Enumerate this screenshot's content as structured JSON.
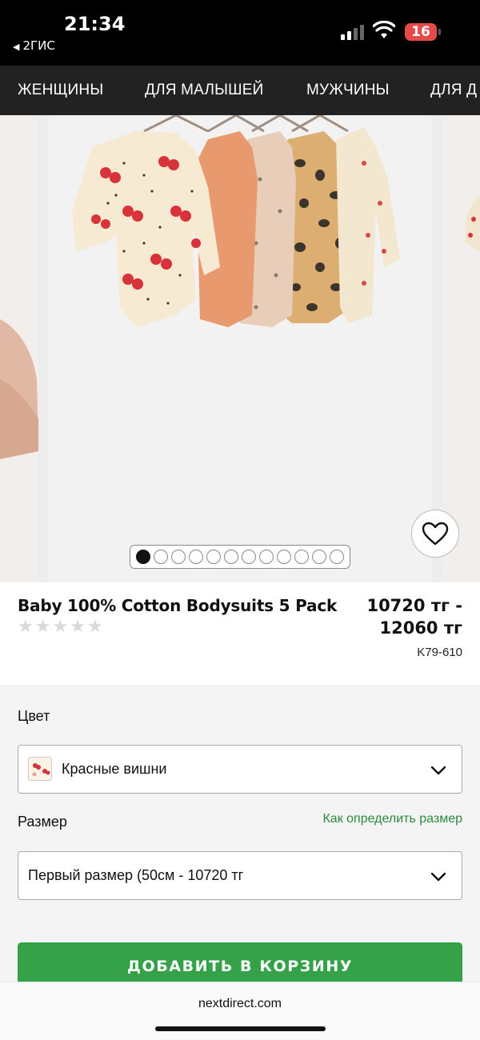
{
  "status_bar": {
    "time": "21:34",
    "back_app": "2ГИС",
    "battery": "16"
  },
  "nav": {
    "items": [
      "ЖЕНЩИНЫ",
      "ДЛЯ МАЛЫШЕЙ",
      "МУЖЧИНЫ",
      "ДЛЯ Д"
    ]
  },
  "gallery": {
    "image_count": 12,
    "active_index": 0
  },
  "product": {
    "title": "Baby 100% Cotton Bodysuits 5 Pack",
    "rating": 0,
    "price_line1": "10720 тг -",
    "price_line2": "12060 тг",
    "sku": "K79-610"
  },
  "options": {
    "color_label": "Цвет",
    "color_value": "Красные вишни",
    "size_label": "Размер",
    "size_guide_link": "Как определить размер",
    "size_value": "Первый размер (50см - 10720 тг"
  },
  "cta": {
    "label": "ДОБАВИТЬ В КОРЗИНУ"
  },
  "browser": {
    "url": "nextdirect.com"
  },
  "colors": {
    "nav_bg": "#222222",
    "cta_green": "#35a24a",
    "link_green": "#2d8a3e",
    "battery_red": "#e54b4b"
  }
}
